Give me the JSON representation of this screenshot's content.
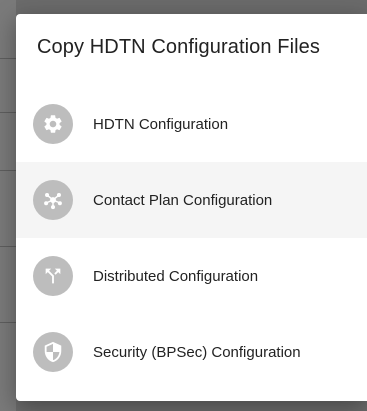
{
  "dialog": {
    "title": "Copy HDTN Configuration Files",
    "options": [
      {
        "label": "HDTN Configuration",
        "icon": "gear-icon",
        "selected": false
      },
      {
        "label": "Contact Plan Configuration",
        "icon": "network-hub-icon",
        "selected": true
      },
      {
        "label": "Distributed Configuration",
        "icon": "call-split-icon",
        "selected": false
      },
      {
        "label": "Security (BPSec) Configuration",
        "icon": "shield-icon",
        "selected": false
      }
    ]
  },
  "colors": {
    "backdrop": "#6b6b6b",
    "surface": "#ffffff",
    "avatar": "#bdbdbd",
    "selected_row": "#f5f5f5",
    "text": "#222222"
  }
}
